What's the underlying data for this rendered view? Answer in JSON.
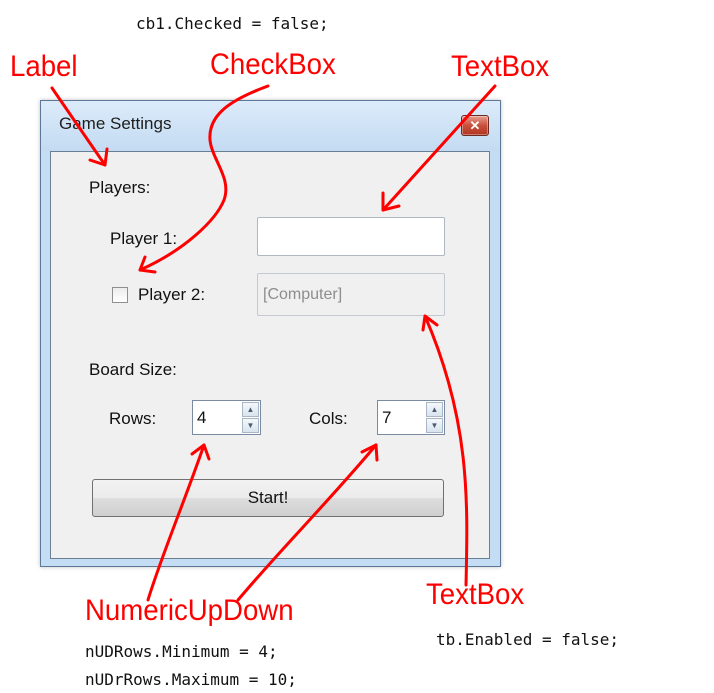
{
  "code": {
    "cb1": "cb1.Checked = false;",
    "tb": "tb.Enabled = false;",
    "nud_min": "nUDRows.Minimum = 4;",
    "nud_max": "nUDrRows.Maximum = 10;"
  },
  "annotations": {
    "label": "Label",
    "checkbox": "CheckBox",
    "textbox_top": "TextBox",
    "textbox_bottom": "TextBox",
    "numeric": "NumericUpDown"
  },
  "window": {
    "title": "Game Settings",
    "close_glyph": "✕",
    "players_label": "Players:",
    "player1_label": "Player 1:",
    "player1_value": "",
    "player2_label": "Player 2:",
    "player2_value": "[Computer]",
    "player2_checked": false,
    "board_label": "Board Size:",
    "rows_label": "Rows:",
    "rows_value": "4",
    "cols_label": "Cols:",
    "cols_value": "7",
    "start_label": "Start!"
  },
  "colors": {
    "annotation": "#ff0000",
    "window_frame": "#c4dcf4",
    "client_bg": "#f0f0f0"
  },
  "icons": [
    "close-icon",
    "spin-up-icon",
    "spin-down-icon",
    "arrow-annotation"
  ]
}
